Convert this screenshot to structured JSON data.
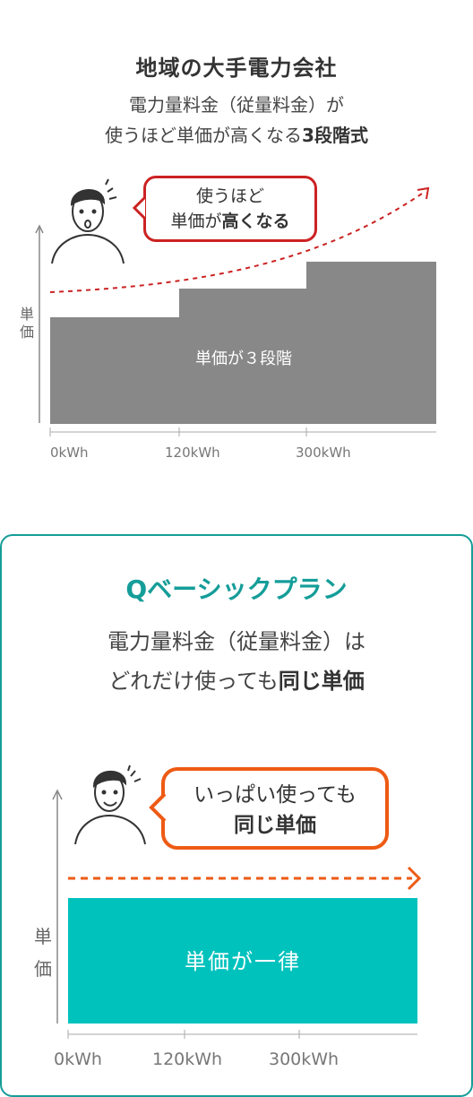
{
  "card1": {
    "title": "地域の大手電力会社",
    "desc_line1": "電力量料金（従量料金）が",
    "desc_line2_pre": "使うほど単価が高くなる",
    "desc_line2_bold": "3段階式",
    "bubble_line1": "使うほど",
    "bubble_line2_pre": "単価が",
    "bubble_line2_bold": "高くなる",
    "ylabel": "単価",
    "bar_label": "単価が３段階",
    "bar_color": "#888888",
    "accent_color": "#cc2222"
  },
  "card2": {
    "title": "Qベーシックプラン",
    "desc_line1": "電力量料金（従量料金）は",
    "desc_line2_pre": "どれだけ使っても",
    "desc_line2_bold": "同じ単価",
    "bubble_line1": "いっぱい使っても",
    "bubble_line2_bold": "同じ単価",
    "ylabel": "単価",
    "bar_label": "単価が一律",
    "bar_color": "#00c2bd",
    "accent_color": "#ee5a14",
    "border_color": "#159d99"
  },
  "chart_data": [
    {
      "type": "bar",
      "categories": [
        "0kWh",
        "120kWh",
        "300kWh"
      ],
      "values": [
        1,
        2,
        3
      ],
      "ylabel": "単価"
    },
    {
      "type": "bar",
      "categories": [
        "0kWh",
        "120kWh",
        "300kWh"
      ],
      "values": [
        1,
        1,
        1
      ],
      "ylabel": "単価"
    }
  ]
}
